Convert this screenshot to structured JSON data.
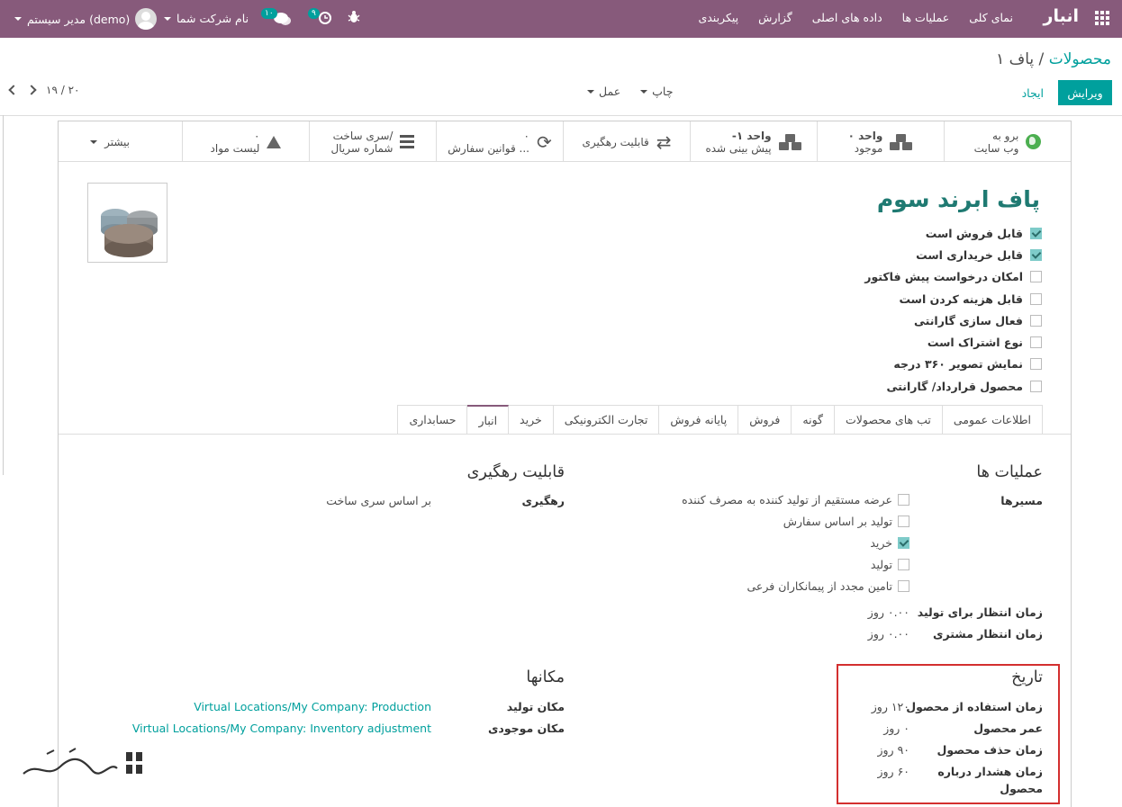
{
  "navbar": {
    "brand": "انبار",
    "menu": [
      "نمای کلی",
      "عملیات ها",
      "داده های اصلی",
      "گزارش",
      "پیکربندی"
    ],
    "user": "مدیر سیستم (demo)",
    "company": "نام شرکت شما",
    "chat_count": "۱۰",
    "activity_count": "۹",
    "color": "#875a7b"
  },
  "breadcrumb": {
    "parent": "محصولات",
    "separator": "/",
    "current": "پاف ۱"
  },
  "buttons": {
    "edit": "ویرایش",
    "create": "ایجاد",
    "print": "چاپ",
    "action": "عمل"
  },
  "pager": {
    "value": "۱۹ / ۲۰"
  },
  "smart_buttons": [
    {
      "line1": "برو به",
      "line2": "وب سایت",
      "icon": "globe-icon"
    },
    {
      "line1": "۰ واحد",
      "line2": "موجود",
      "icon": "cubes-icon"
    },
    {
      "line1": "-۱ واحد",
      "line2": "پیش بینی شده",
      "icon": "cubes-icon"
    },
    {
      "line1": "قابلیت رهگیری",
      "line2": "",
      "icon": "exchange-icon"
    },
    {
      "line1": "۰",
      "line2": "قوانین سفارش ...",
      "icon": "refresh-icon"
    },
    {
      "line1": "سری ساخت/",
      "line2": "شماره سریال",
      "icon": "bars-icon"
    },
    {
      "line1": "۰",
      "line2": "لیست مواد",
      "icon": "flask-icon"
    },
    {
      "line1": "بیشتر",
      "line2": "",
      "icon": "caret-down-icon"
    }
  ],
  "product": {
    "name": "پاف ابرند سوم",
    "checkboxes": [
      {
        "label": "قابل فروش است",
        "checked": true
      },
      {
        "label": "قابل خریداری است",
        "checked": true
      },
      {
        "label": "امکان درخواست پیش فاکتور",
        "checked": false
      },
      {
        "label": "قابل هزینه کردن است",
        "checked": false
      },
      {
        "label": "فعال سازی گارانتی",
        "checked": false
      },
      {
        "label": "نوع اشتراک است",
        "checked": false
      },
      {
        "label": "نمایش تصویر ۳۶۰ درجه",
        "checked": false
      },
      {
        "label": "محصول قرارداد/ گارانتی",
        "checked": false
      }
    ]
  },
  "tabs": [
    "اطلاعات عمومی",
    "تب های محصولات",
    "گونه",
    "فروش",
    "پایانه فروش",
    "تجارت الکترونیکی",
    "خرید",
    "انبار",
    "حسابداری"
  ],
  "active_tab": "انبار",
  "operations": {
    "title": "عملیات ها",
    "routes_label": "مسیرها",
    "routes": [
      {
        "label": "عرضه مستقیم از تولید کننده به مصرف کننده",
        "checked": false
      },
      {
        "label": "تولید بر اساس سفارش",
        "checked": false
      },
      {
        "label": "خرید",
        "checked": true
      },
      {
        "label": "تولید",
        "checked": false
      },
      {
        "label": "تامین مجدد از پیمانکاران فرعی",
        "checked": false
      }
    ],
    "mfg_lead_label": "زمان انتظار برای تولید",
    "mfg_lead_value": "۰.۰۰ روز",
    "cust_lead_label": "زمان انتظار مشتری",
    "cust_lead_value": "۰.۰۰ روز"
  },
  "traceability": {
    "title": "قابلیت رهگیری",
    "tracking_label": "رهگیری",
    "tracking_value": "بر اساس سری ساخت"
  },
  "dates": {
    "title": "تاریخ",
    "use_time_label": "زمان استفاده از محصول",
    "use_time_value": "۱۲۰ روز",
    "life_time_label": "عمر محصول",
    "life_time_value": "۰ روز",
    "removal_time_label": "زمان حذف محصول",
    "removal_time_value": "۹۰ روز",
    "alert_time_label_1": "زمان هشدار درباره",
    "alert_time_label_2": "محصول",
    "alert_time_value": "۶۰ روز"
  },
  "locations": {
    "title": "مکانها",
    "production_label": "مکان تولید",
    "production_value": "Virtual Locations/My Company: Production",
    "inventory_label": "مکان موجودی",
    "inventory_value": "Virtual Locations/My Company: Inventory adjustment"
  }
}
